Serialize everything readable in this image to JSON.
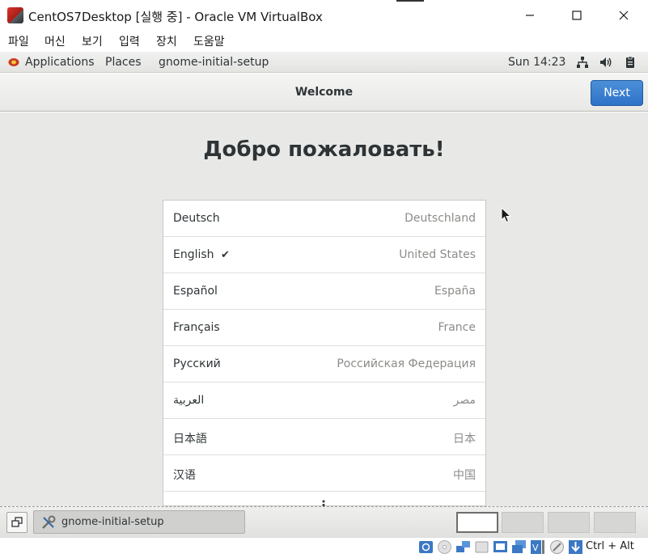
{
  "window": {
    "title": "CentOS7Desktop [실행 중] - Oracle VM VirtualBox"
  },
  "menubar": {
    "items": [
      "파일",
      "머신",
      "보기",
      "입력",
      "장치",
      "도움말"
    ]
  },
  "gnome_topbar": {
    "applications": "Applications",
    "places": "Places",
    "active_app": "gnome-initial-setup",
    "clock": "Sun 14:23",
    "tray_icons": [
      "network-icon",
      "volume-icon",
      "clipboard-icon"
    ]
  },
  "header": {
    "title": "Welcome",
    "next_label": "Next"
  },
  "content": {
    "welcome": "Добро пожаловать!",
    "languages": [
      {
        "name": "Deutsch",
        "region": "Deutschland",
        "selected": false
      },
      {
        "name": "English",
        "region": "United States",
        "selected": true
      },
      {
        "name": "Español",
        "region": "España",
        "selected": false
      },
      {
        "name": "Français",
        "region": "France",
        "selected": false
      },
      {
        "name": "Русский",
        "region": "Российская Федерация",
        "selected": false
      },
      {
        "name": "العربية",
        "region": "مصر",
        "selected": false
      },
      {
        "name": "日本語",
        "region": "日本",
        "selected": false
      },
      {
        "name": "汉语",
        "region": "中国",
        "selected": false
      }
    ],
    "check_glyph": "✔"
  },
  "taskbar": {
    "task_label": "gnome-initial-setup",
    "workspaces": 4,
    "active_workspace": 1
  },
  "statusbar": {
    "host_key": "Ctrl + Alt"
  },
  "colors": {
    "accent": "#2c72c7",
    "content_bg": "#e8e8e7"
  }
}
